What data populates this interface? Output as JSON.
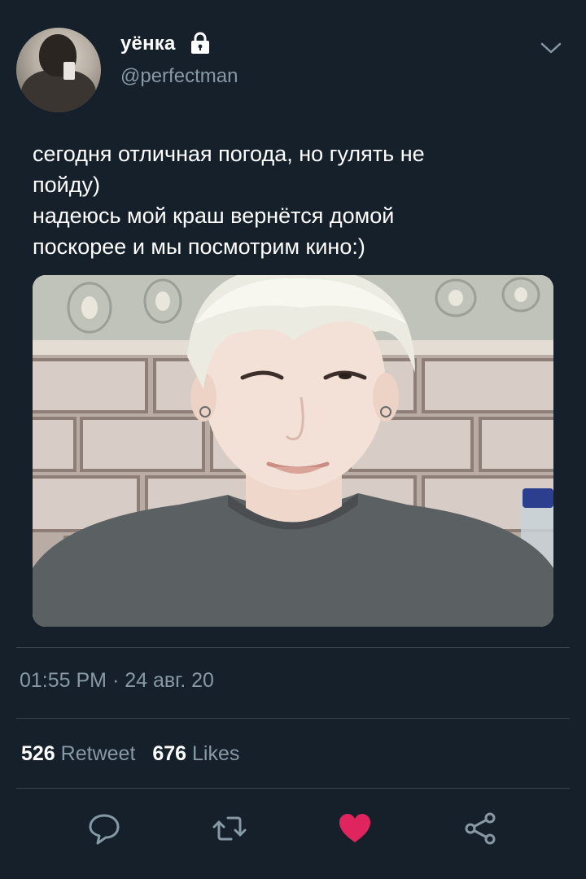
{
  "user": {
    "display_name": "уёнка",
    "handle": "@perfectman",
    "avatar": "profile-photo"
  },
  "icons": {
    "lock": "lock-icon",
    "menu": "chevron-down-icon",
    "reply": "comment-icon",
    "retweet": "retweet-icon",
    "like": "heart-icon",
    "share": "share-icon"
  },
  "tweet": {
    "text_lines": [
      "сегодня отличная погода, но гулять не",
      "пойду)",
      "надеюсь мой краш вернётся домой",
      "поскорее и мы посмотрим кино:)"
    ],
    "timestamp": "01:55 PM · 24 авг. 20"
  },
  "stats": {
    "retweets": "526",
    "retweet_label": "Retweet",
    "likes": "676",
    "likes_label": "Likes"
  },
  "colors": {
    "background": "#15202b",
    "secondary_text": "#8899a6",
    "divider": "#38444d",
    "like_active": "#e0245e"
  },
  "actions": {
    "liked": true
  }
}
